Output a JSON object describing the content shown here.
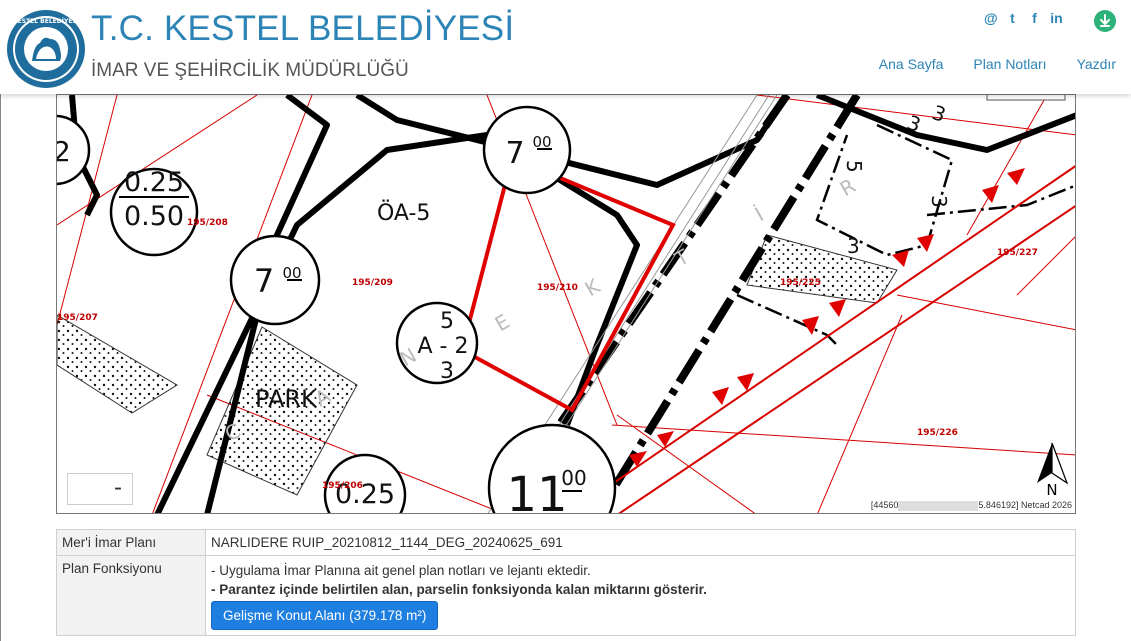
{
  "header": {
    "title": "T.C. KESTEL BELEDİYESİ",
    "subtitle": "İMAR VE ŞEHİRCİLİK MÜDÜRLÜĞÜ",
    "logo_text": "KESTEL BELEDİYESİ",
    "social": [
      "@",
      "t",
      "f",
      "in"
    ],
    "nav": [
      "Ana Sayfa",
      "Plan Notları",
      "Yazdır"
    ]
  },
  "map": {
    "zoom_out_label": "-",
    "north_label": "N",
    "attribution_prefix": "[44560",
    "attribution_suffix": "5.846192] Netcad 2026",
    "labels": {
      "oa5": "ÖA-5",
      "park": "PARK",
      "c7a": "7",
      "c7a_sup": "00",
      "c7b": "7",
      "c7b_sup": "00",
      "c025a_top": "0.25",
      "c025a_bot": "0.50",
      "c025b": "0.25",
      "c11": "11",
      "c11_sup": "00",
      "ca_top": "5",
      "ca_mid": "A - 2",
      "ca_bot": "3",
      "c2": "2",
      "n5": "5",
      "n3a": "3",
      "n3b": "3",
      "n3c": "3",
      "n3d": "3",
      "parcel_208": "195/208",
      "parcel_209": "195/209",
      "parcel_210": "195/210",
      "parcel_207": "195/207",
      "parcel_206": "195/206",
      "parcel_225": "195/225",
      "parcel_227": "195/227",
      "parcel_226": "195/226",
      "wm_e": "E",
      "wm_k": "K",
      "wm_t": "T",
      "wm_i": "İ",
      "wm_r": "R",
      "wm_a": "A",
      "wm_n": "N",
      "wm_c": "C"
    }
  },
  "info": {
    "rows": [
      {
        "key": "Mer'i İmar Planı",
        "value": "NARLIDERE RUIP_20210812_1144_DEG_20240625_691"
      },
      {
        "key": "Plan Fonksiyonu",
        "line1": "- Uygulama İmar Planına ait genel plan notları ve lejantı ektedir.",
        "line2": "- Parantez içinde belirtilen alan, parselin fonksiyonda kalan miktarını gösterir.",
        "button": "Gelişme Konut Alanı (379.178 m²)"
      }
    ]
  },
  "colors": {
    "brand": "#2d84b6",
    "parcel": "#d80000",
    "button": "#1f7fe0"
  }
}
